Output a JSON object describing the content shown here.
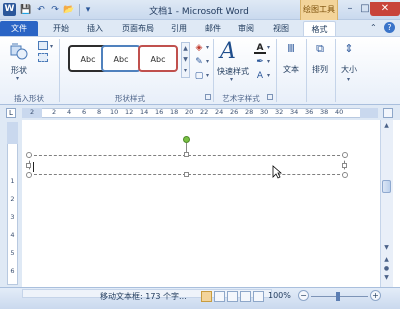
{
  "window": {
    "title": "文档1 - Microsoft Word",
    "context_group": "绘图工具"
  },
  "titlebar": {
    "minimize": "–",
    "maximize": "□",
    "close": "✕"
  },
  "tabs": [
    {
      "label": "文件"
    },
    {
      "label": "开始"
    },
    {
      "label": "插入"
    },
    {
      "label": "页面布局"
    },
    {
      "label": "引用"
    },
    {
      "label": "邮件"
    },
    {
      "label": "审阅"
    },
    {
      "label": "视图"
    },
    {
      "label": "格式"
    }
  ],
  "ribbon": {
    "insert_shapes": {
      "shape_button": "形状",
      "group_label": "插入形状"
    },
    "shape_styles": {
      "samples": [
        "Abc",
        "Abc",
        "Abc"
      ],
      "group_label": "形状样式"
    },
    "wordart": {
      "quick_styles": "快速样式",
      "group_label": "艺术字样式"
    },
    "text": {
      "label": "文本"
    },
    "arrange": {
      "label": "排列"
    },
    "size": {
      "label": "大小"
    }
  },
  "ruler": {
    "corner_mark": "L",
    "numbers": [
      "2",
      "2",
      "4",
      "6",
      "8",
      "10",
      "12",
      "14",
      "16",
      "18",
      "20",
      "22",
      "24",
      "26",
      "28",
      "30",
      "32",
      "34",
      "36",
      "38",
      "40"
    ],
    "vertical_numbers": [
      "1",
      "2",
      "3",
      "4",
      "5",
      "6"
    ]
  },
  "statusbar": {
    "text": "移动文本框: 173 个字...",
    "zoom": "100%",
    "zoom_minus": "−",
    "zoom_plus": "+"
  },
  "colors": {
    "file_tab": "#2a64c5",
    "shape_style_1": "#2d2d2d",
    "shape_style_2": "#4f81bd",
    "shape_style_3": "#c0504d",
    "context_tab": "#f3d49a",
    "rotate_handle": "#79c143"
  }
}
